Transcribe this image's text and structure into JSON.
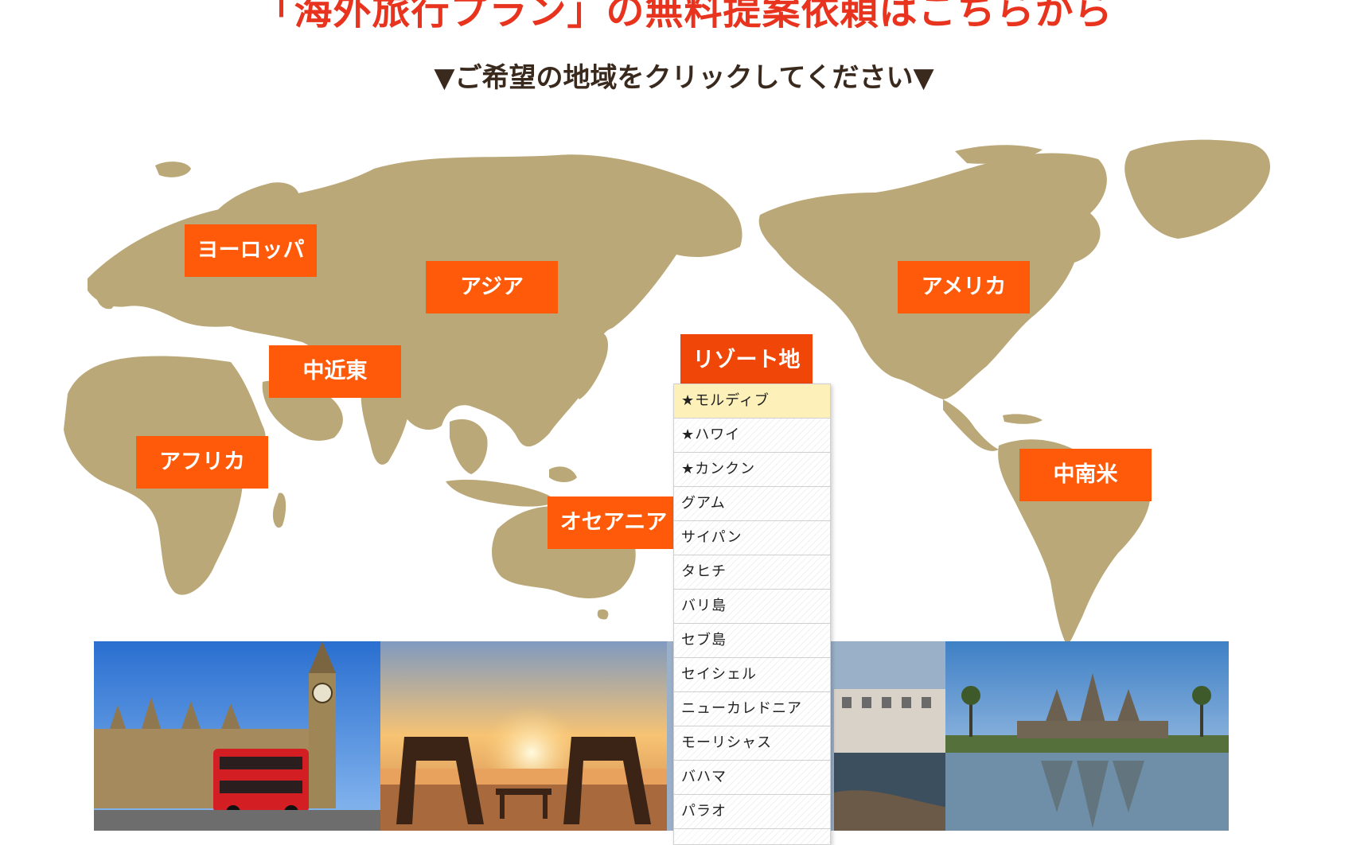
{
  "header": {
    "title": "「海外旅行プラン」の無料提案依頼はこちらから",
    "subtitle": "▼ご希望の地域をクリックしてください▼"
  },
  "colors": {
    "title": "#e8331e",
    "region_button": "#ff5a0a",
    "map_land": "#bba878",
    "dropdown_hover": "#fdf0b8"
  },
  "regions": [
    {
      "id": "europe",
      "label": "ヨーロッパ"
    },
    {
      "id": "asia",
      "label": "アジア"
    },
    {
      "id": "america",
      "label": "アメリカ"
    },
    {
      "id": "middle-east",
      "label": "中近東"
    },
    {
      "id": "resort",
      "label": "リゾート地"
    },
    {
      "id": "africa",
      "label": "アフリカ"
    },
    {
      "id": "latin-america",
      "label": "中南米"
    },
    {
      "id": "oceania",
      "label": "オセアニア"
    }
  ],
  "resort_dropdown": {
    "items": [
      "★モルディブ",
      "★ハワイ",
      "★カンクン",
      "グアム",
      "サイパン",
      "タヒチ",
      "バリ島",
      "セブ島",
      "セイシェル",
      "ニューカレドニア",
      "モーリシャス",
      "バハマ",
      "パラオ"
    ],
    "hovered_index": 0
  },
  "photos": [
    {
      "subject": "london"
    },
    {
      "subject": "beach-sunset"
    },
    {
      "subject": "harbor-city"
    },
    {
      "subject": "angkor-wat"
    }
  ]
}
